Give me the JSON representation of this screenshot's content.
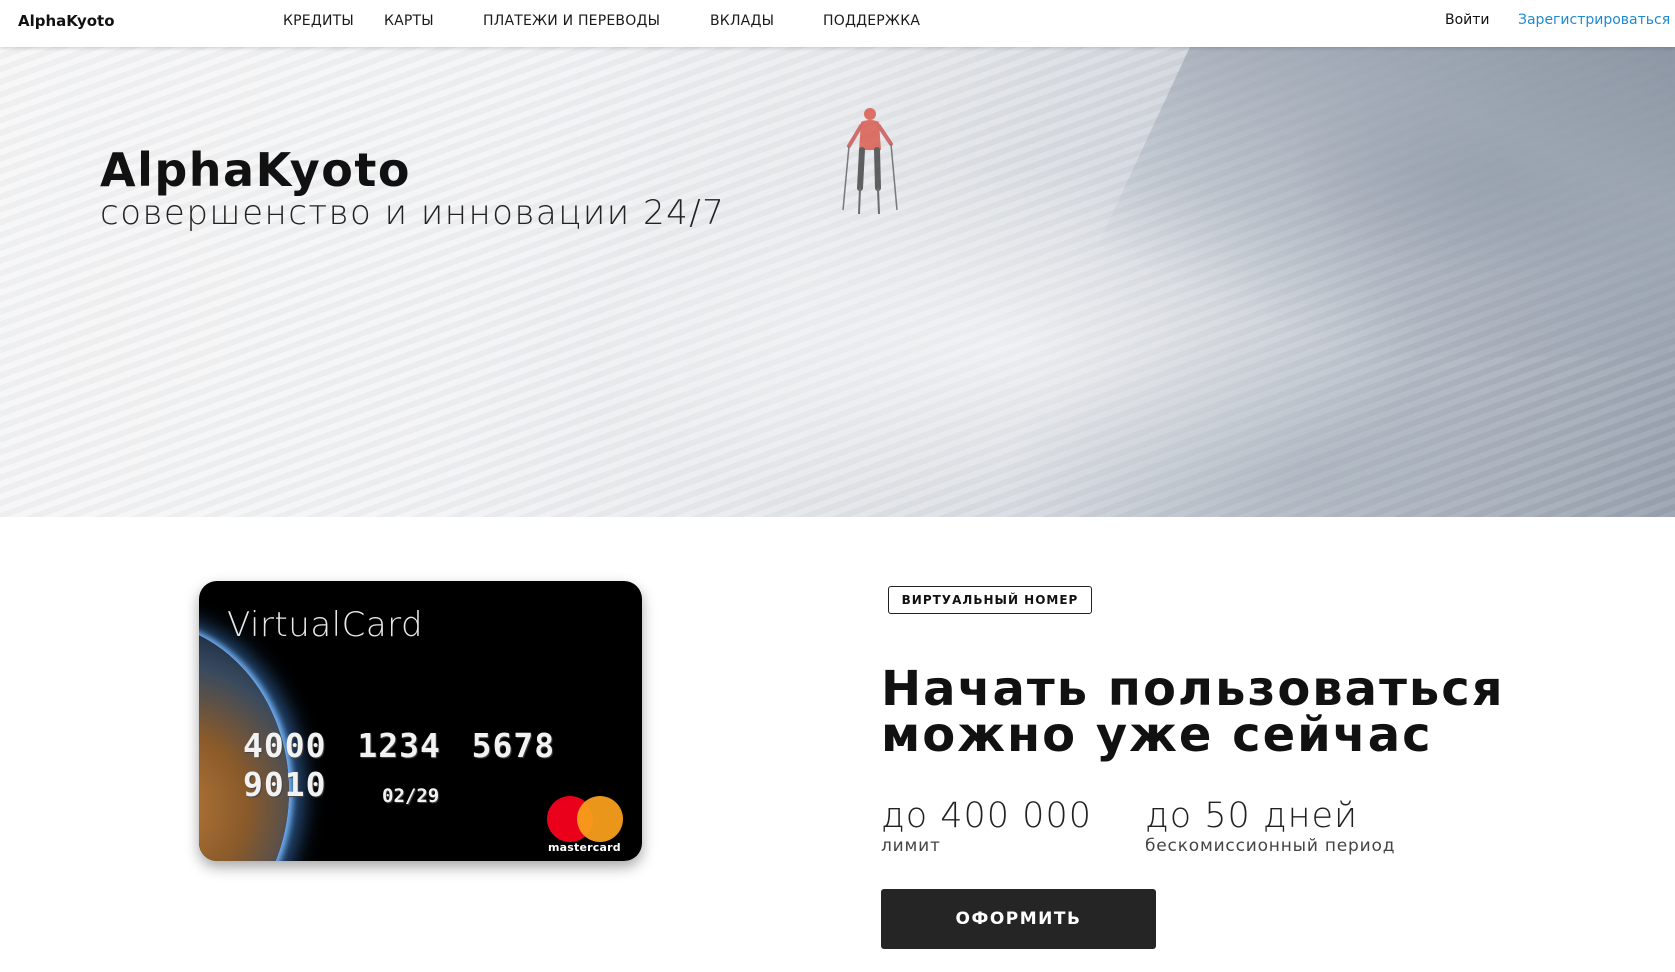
{
  "header": {
    "logo": "AlphaKyoto",
    "nav": [
      "КРЕДИТЫ",
      "КАРТЫ",
      "ПЛАТЕЖИ И ПЕРЕВОДЫ",
      "ВКЛАДЫ",
      "ПОДДЕРЖКА"
    ],
    "login": "Войти",
    "register": "Зарегистрироваться"
  },
  "hero": {
    "title": "AlphaKyoto",
    "subtitle": "совершенство и инновации 24/7"
  },
  "card": {
    "name": "VirtualCard",
    "number": "4000 1234 5678 9010",
    "expiry": "02/29",
    "brand": "mastercard"
  },
  "offer": {
    "badge": "ВИРТУАЛЬНЫЙ НОМЕР",
    "title_line1": "Начать пользоваться",
    "title_line2": "можно уже сейчас",
    "stats": [
      {
        "value": "до 400 000",
        "label": "лимит"
      },
      {
        "value": "до 50 дней",
        "label": "бескомиссионный период"
      }
    ],
    "cta": "ОФОРМИТЬ"
  },
  "colors": {
    "accent_link": "#1e8bd0",
    "button_bg": "#252525",
    "mastercard_red": "#eb001b",
    "mastercard_yellow": "#f79e1b"
  }
}
